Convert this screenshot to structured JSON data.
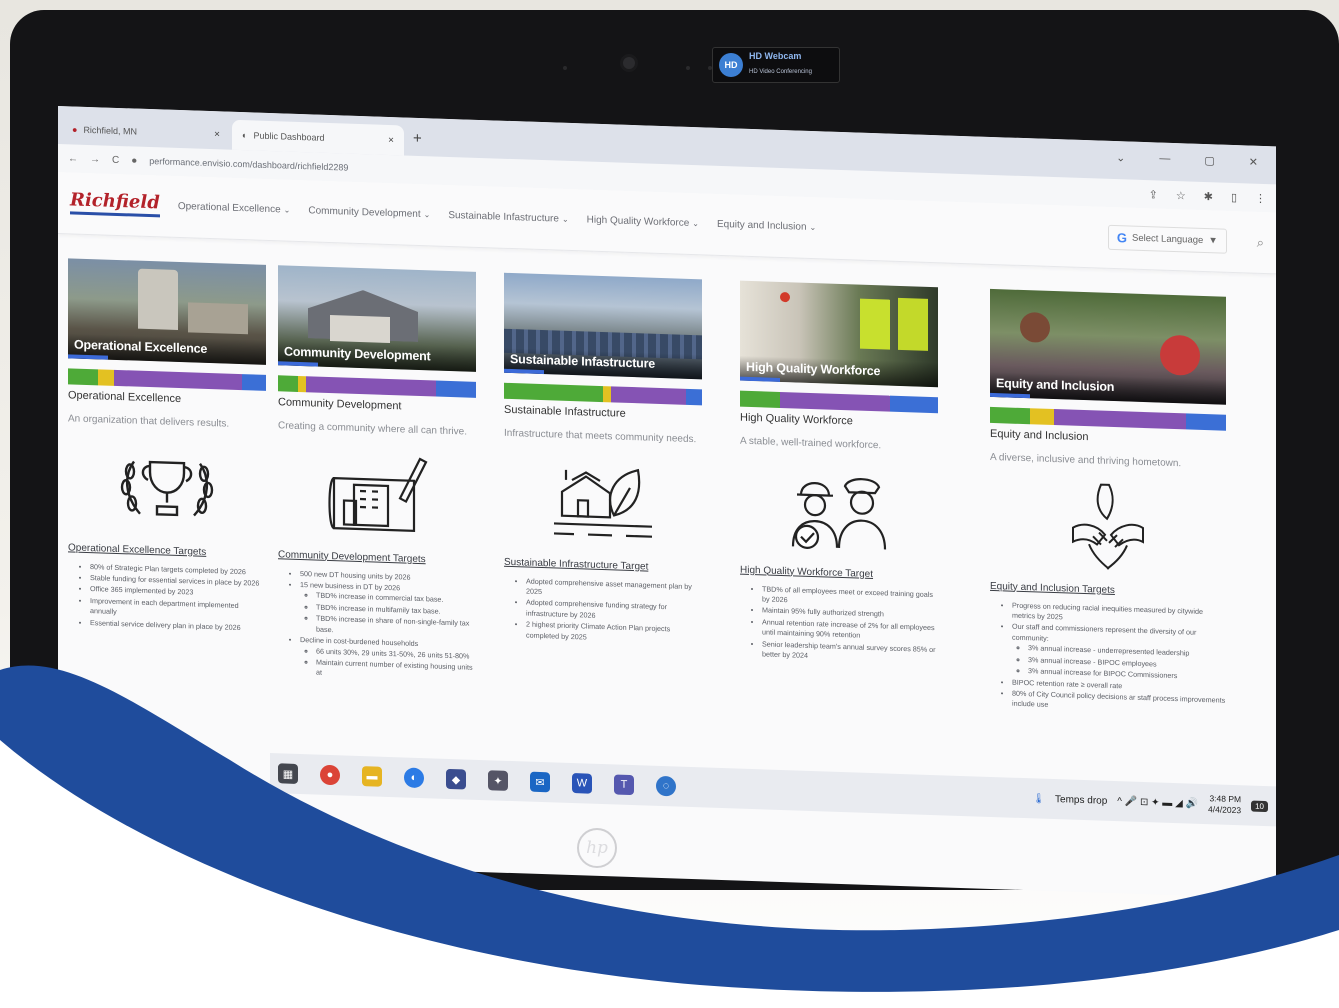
{
  "webcam": {
    "badge": "HD",
    "title": "HD Webcam",
    "subtitle": "HD Video Conferencing"
  },
  "browser": {
    "tabs": [
      {
        "label": "Richfield, MN",
        "close": "×"
      },
      {
        "label": "Public Dashboard",
        "close": "×"
      }
    ],
    "new_tab": "+",
    "window_controls": [
      "⌄",
      "—",
      "▢",
      "✕"
    ],
    "nav": [
      "←",
      "→",
      "C"
    ],
    "url": "performance.envisio.com/dashboard/richfield2289",
    "addr_icons": [
      "⇪",
      "☆",
      "✱",
      "▯",
      "⋮"
    ]
  },
  "site": {
    "logo": "Richfield",
    "nav": [
      {
        "label": "Operational Excellence"
      },
      {
        "label": "Community Development"
      },
      {
        "label": "Sustainable Infastructure"
      },
      {
        "label": "High Quality Workforce"
      },
      {
        "label": "Equity and Inclusion"
      }
    ],
    "chevron": "⌄",
    "language": {
      "g": "G",
      "label": "Select Language",
      "caret": "▼"
    },
    "search_icon": "⌕"
  },
  "cards": [
    {
      "photo_caption": "Operational Excellence",
      "title": "Operational Excellence",
      "description": "An organization that delivers results.",
      "icon": "trophy-wreath-icon",
      "bar": [
        0.15,
        0.08,
        0.65,
        0.12
      ],
      "targets_heading": "Operational Excellence Targets",
      "targets": [
        {
          "text": "80% of Strategic Plan targets completed by 2026"
        },
        {
          "text": "Stable funding for essential services in place by 2026"
        },
        {
          "text": "Office 365 implemented by 2023"
        },
        {
          "text": "Improvement in each department implemented annually"
        },
        {
          "text": "Essential service delivery plan in place by 2026"
        }
      ]
    },
    {
      "photo_caption": "Community Development",
      "title": "Community Development",
      "description": "Creating a community where all can thrive.",
      "icon": "building-blueprint-icon",
      "bar": [
        0.1,
        0.04,
        0.66,
        0.2
      ],
      "targets_heading": "Community Development Targets",
      "targets": [
        {
          "text": "500 new DT housing units by 2026"
        },
        {
          "text": "15 new business in DT by 2026",
          "sub": [
            "TBD% increase in commercial tax base.",
            "TBD% increase in multifamily tax base.",
            "TBD% increase in share of non-single-family tax base."
          ]
        },
        {
          "text": "Decline in cost-burdened households",
          "sub": [
            "66 units 30%, 29 units 31-50%, 26 units 51-80%",
            "Maintain current number of existing housing units at"
          ]
        }
      ]
    },
    {
      "photo_caption": "Sustainable Infastructure",
      "title": "Sustainable Infastructure",
      "description": "Infrastructure that meets community needs.",
      "icon": "house-leaf-icon",
      "bar": [
        0.5,
        0.04,
        0.38,
        0.08
      ],
      "targets_heading": "Sustainable Infrastructure Target",
      "targets": [
        {
          "text": "Adopted comprehensive asset management plan by 2025"
        },
        {
          "text": "Adopted comprehensive funding strategy for infrastructure by 2026"
        },
        {
          "text": "2 highest priority Climate Action Plan projects completed by 2025"
        }
      ]
    },
    {
      "photo_caption": "High Quality Workforce",
      "title": "High Quality Workforce",
      "description": "A stable, well-trained workforce.",
      "icon": "workers-check-icon",
      "bar": [
        0.2,
        0.0,
        0.56,
        0.24
      ],
      "targets_heading": "High Quality Workforce Target",
      "targets": [
        {
          "text": "TBD% of all employees meet or exceed training goals by 2026"
        },
        {
          "text": "Maintain 95% fully authorized strength"
        },
        {
          "text": "Annual retention rate increase of 2% for all employees until maintaining 90% retention"
        },
        {
          "text": "Senior leadership team's annual survey scores 85% or better by 2024"
        }
      ]
    },
    {
      "photo_caption": "Equity and Inclusion",
      "title": "Equity and Inclusion",
      "description": "A diverse, inclusive and thriving hometown.",
      "icon": "joined-hands-icon",
      "bar": [
        0.17,
        0.1,
        0.56,
        0.17
      ],
      "targets_heading": "Equity and Inclusion Targets",
      "targets": [
        {
          "text": "Progress on reducing racial inequities measured by citywide metrics by 2025"
        },
        {
          "text": "Our staff and commissioners represent the diversity of our community:",
          "sub": [
            "3% annual increase - underrepresented leadership",
            "3% annual increase - BIPOC employees",
            "3% annual increase for BIPOC Commissioners"
          ]
        },
        {
          "text": "BIPOC retention rate ≥ overall rate"
        },
        {
          "text": "80% of City Council policy decisions ar staff process improvements include use"
        }
      ]
    }
  ],
  "colors": {
    "green": "#4eaa38",
    "yellow": "#e3c122",
    "purple": "#8553b4",
    "blue": "#3b6fd6",
    "brand_red": "#b3222a",
    "swoosh": "#1f4c9c"
  },
  "taskbar": {
    "search": "search",
    "weather": "Temps drop",
    "tray": "^ 🎤 ⊡ ✦ ▬ ◢ 🔊",
    "time": "3:48 PM",
    "date": "4/4/2023",
    "badge": "10"
  },
  "laptop_brand": "hp"
}
